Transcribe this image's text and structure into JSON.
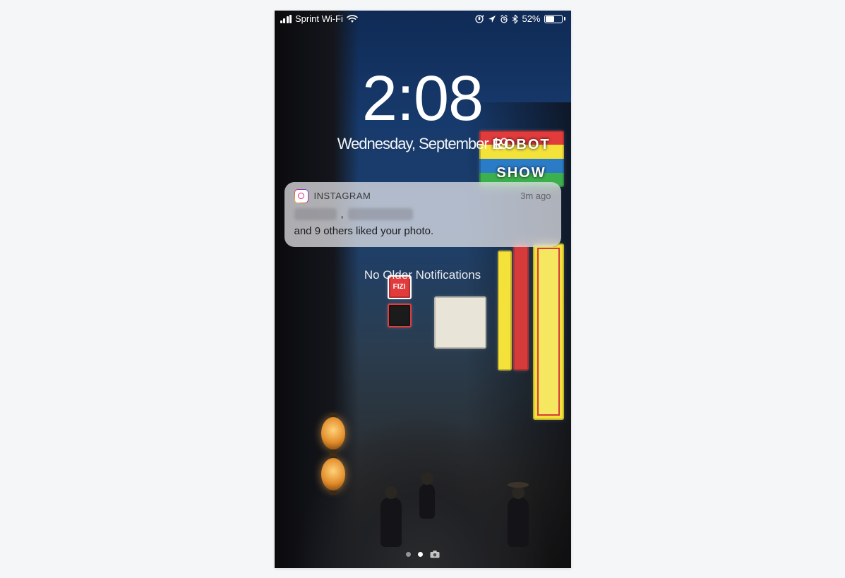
{
  "status": {
    "carrier": "Sprint Wi-Fi",
    "battery_pct": "52%"
  },
  "clock": {
    "time": "2:08",
    "date": "Wednesday, September 19"
  },
  "notification": {
    "app_name": "INSTAGRAM",
    "time": "3m ago",
    "redacted1": "xxxxxx",
    "sep": ",",
    "redacted2": "xxxxxxxxxx",
    "suffix": "and 9 others liked your photo."
  },
  "lockscreen": {
    "no_older": "No Older Notifications"
  },
  "bg_signs": {
    "robot_l1": "ROBOT",
    "robot_l2": "SHOW",
    "fizi": "FIZI"
  }
}
